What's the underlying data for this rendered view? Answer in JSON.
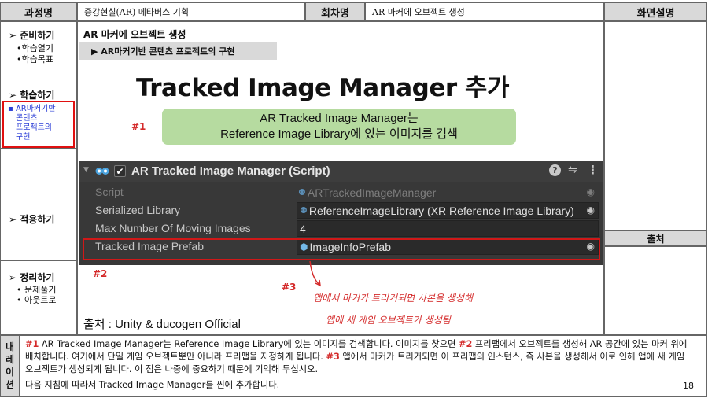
{
  "header": {
    "course_label": "과정명",
    "course_value": "증강현실(AR) 메타버스 기획",
    "session_label": "회차명",
    "session_value": "AR 마커에 오브젝트 생성",
    "screen_desc_label": "화면설명"
  },
  "sidebar": {
    "sections": [
      {
        "title": "준비하기",
        "items": [
          "•학습열기",
          "•학습목표"
        ]
      },
      {
        "title": "학습하기",
        "items": []
      },
      {
        "current_label": "AR마커기반 콘텐츠 프로젝트의 구현"
      },
      {
        "title": "적용하기",
        "items": []
      },
      {
        "title": "정리하기",
        "items": [
          "• 문제풀기",
          "• 아웃트로"
        ]
      }
    ],
    "current_lines": [
      "AR마커기반",
      "콘텐츠",
      "프로젝트의",
      "구현"
    ]
  },
  "main": {
    "title": "AR 마커에 오브젝트 생성",
    "subtitle": "▶ AR마커기반 콘텐츠 프로젝트의 구현",
    "slide_title": "Tracked Image Manager 추가",
    "green_box_line1": "AR Tracked Image Manager는",
    "green_box_line2": "Reference Image Library에 있는 이미지를 검색",
    "marker1": "#1",
    "marker2": "#2",
    "marker3": "#3",
    "handwritten_line1": "앱에서 마커가 트리거되면 사본을 생성해",
    "handwritten_line2": "앱에 새 게임 오브젝트가 생성됨",
    "source_text": "출처 : Unity & ducogen Official"
  },
  "unity": {
    "component_title": "AR Tracked Image Manager (Script)",
    "rows": [
      {
        "label": "Script",
        "value": "ARTrackedImageManager"
      },
      {
        "label": "Serialized Library",
        "value": "ReferenceImageLibrary (XR Reference Image Library)"
      },
      {
        "label": "Max Number Of Moving Images",
        "value": "4"
      },
      {
        "label": "Tracked Image Prefab",
        "value": "ImageInfoPrefab"
      }
    ]
  },
  "right_panel": {
    "source_label": "출처"
  },
  "narration": {
    "label_chars": [
      "내",
      "레",
      "이",
      "션"
    ],
    "p1_m1": "#1",
    "p1_a": " AR Tracked Image Manager는 Reference Image Library에 있는 이미지를 검색합니다. 이미지를 찾으면 ",
    "p1_m2": "#2",
    "p1_b": " 프리팹에서 오브젝트를 생성해 AR 공간에 있는 마커 위에 배치합니다. 여기에서 단일 게임 오브젝트뿐만 아니라 프리팹을 지정하게 됩니다. ",
    "p1_m3": "#3",
    "p1_c": " 앱에서 마커가 트리거되면 이 프리팹의 인스턴스, 즉 사본을 생성해서 이로 인해 앱에 새 게임 오브젝트가 생성되게 됩니다. 이 점은 나중에 중요하기 때문에 기억해 두십시오.",
    "p2": "다음 지침에 따라서 Tracked Image Manager를 씬에 추가합니다.",
    "page_number": "18"
  }
}
